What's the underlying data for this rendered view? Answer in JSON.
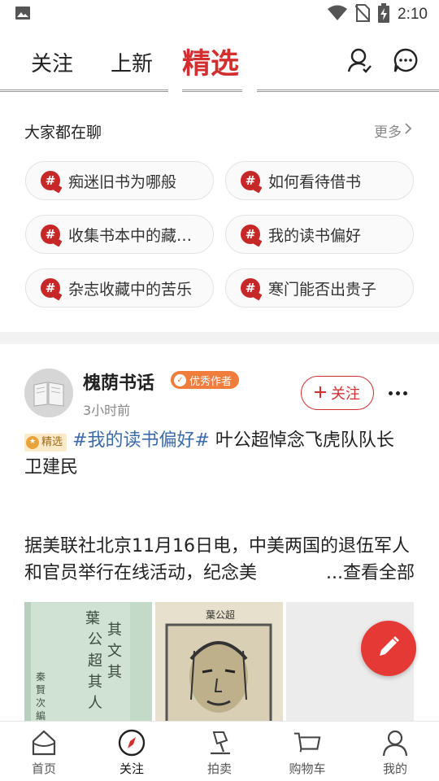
{
  "status_bar": {
    "time": "2:10"
  },
  "top_nav": {
    "tabs": [
      {
        "label": "关注"
      },
      {
        "label": "上新"
      },
      {
        "label": "精选",
        "active": true
      }
    ],
    "accent_color": "#d32f2f"
  },
  "topics": {
    "title": "大家都在聊",
    "more_label": "更多",
    "items": [
      {
        "label": "痴迷旧书为哪般"
      },
      {
        "label": "如何看待借书"
      },
      {
        "label": "收集书本中的藏…"
      },
      {
        "label": "我的读书偏好"
      },
      {
        "label": "杂志收藏中的苦乐"
      },
      {
        "label": "寒门能否出贵子"
      }
    ]
  },
  "post": {
    "author": "槐荫书话",
    "badge": "优秀作者",
    "time": "3小时前",
    "follow_label": "关注",
    "featured_tag": "精选",
    "hashtag": "#我的读书偏好#",
    "title_text": " 叶公超悼念飞虎队队长",
    "byline": "卫建民",
    "excerpt": "据美联社北京11月16日电，中美两国的退伍军人和官员举行在线活动，纪念美",
    "see_all_label": "...查看全部"
  },
  "bottom_nav": {
    "items": [
      {
        "label": "首页",
        "icon": "home-icon"
      },
      {
        "label": "关注",
        "icon": "compass-icon",
        "active": true
      },
      {
        "label": "拍卖",
        "icon": "auction-gavel-icon"
      },
      {
        "label": "购物车",
        "icon": "cart-icon"
      },
      {
        "label": "我的",
        "icon": "profile-icon"
      }
    ]
  }
}
